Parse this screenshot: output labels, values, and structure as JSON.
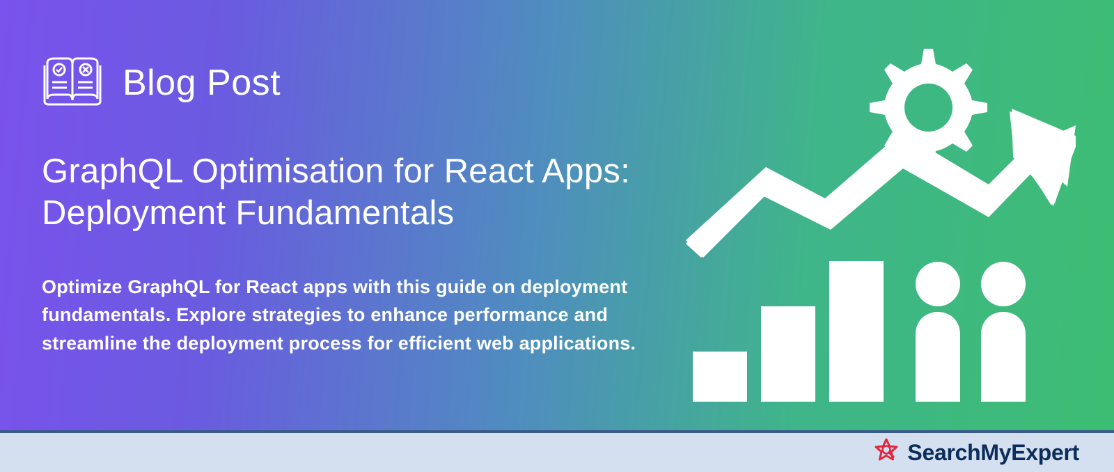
{
  "kicker": "Blog Post",
  "title": "GraphQL Optimisation for React Apps: Deployment Fundamentals",
  "description": "Optimize GraphQL for React apps with this guide on deployment fundamentals. Explore strategies to enhance performance and streamline the deployment process for efficient web applications.",
  "brand": "SearchMyExpert"
}
